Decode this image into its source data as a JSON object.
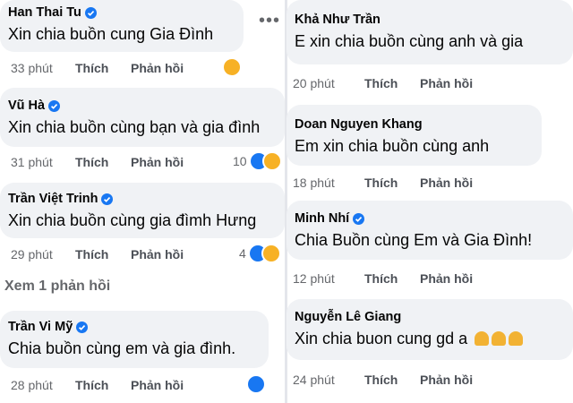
{
  "left_comments": [
    {
      "name": "Han Thai Tu",
      "verified": true,
      "text": "Xin chia buồn cung Gia Đình",
      "time": "33 phút",
      "like": "Thích",
      "reply": "Phản hồi",
      "reactions": {
        "count": "",
        "types": [
          "sad"
        ]
      }
    },
    {
      "name": "Vũ Hà",
      "verified": true,
      "text": "Xin chia buồn cùng bạn và gia đình",
      "time": "31 phút",
      "like": "Thích",
      "reply": "Phản hồi",
      "reactions": {
        "count": "10",
        "types": [
          "like",
          "sad"
        ]
      }
    },
    {
      "name": "Trần Việt Trinh",
      "verified": true,
      "text": "Xin chia buồn cùng gia đìmh Hưng",
      "time": "29 phút",
      "like": "Thích",
      "reply": "Phản hồi",
      "reactions": {
        "count": "4",
        "types": [
          "like",
          "sad"
        ]
      }
    },
    {
      "name": "Trần Vi Mỹ",
      "verified": true,
      "text": "Chia buồn cùng em và gia đình.",
      "time": "28 phút",
      "like": "Thích",
      "reply": "Phản hồi",
      "reactions": {
        "count": "",
        "types": [
          "like"
        ]
      }
    }
  ],
  "view_replies": "Xem 1 phản hồi",
  "more_menu": "•••",
  "right_comments": [
    {
      "name": "Khả Như Trần",
      "verified": false,
      "text": "E xin chia buồn cùng anh và gia",
      "time": "20 phút",
      "like": "Thích",
      "reply": "Phản hồi"
    },
    {
      "name": "Doan Nguyen Khang",
      "verified": false,
      "text": "Em xin chia buồn cùng anh",
      "time": "18 phút",
      "like": "Thích",
      "reply": "Phản hồi"
    },
    {
      "name": "Minh Nhí",
      "verified": true,
      "text": "Chia Buồn cùng Em và Gia Đình!",
      "time": "12 phút",
      "like": "Thích",
      "reply": "Phản hồi"
    },
    {
      "name": "Nguyễn Lê Giang",
      "verified": false,
      "text": "Xin chia buon cung gd a",
      "emoji": "folded-hands x3",
      "time": "24 phút",
      "like": "Thích",
      "reply": "Phản hồi"
    }
  ],
  "colors": {
    "bubble": "#f0f2f5",
    "verified": "#1877f2",
    "meta": "#65676b",
    "like_reaction": "#1877f2",
    "sad_reaction": "#f7b125"
  }
}
